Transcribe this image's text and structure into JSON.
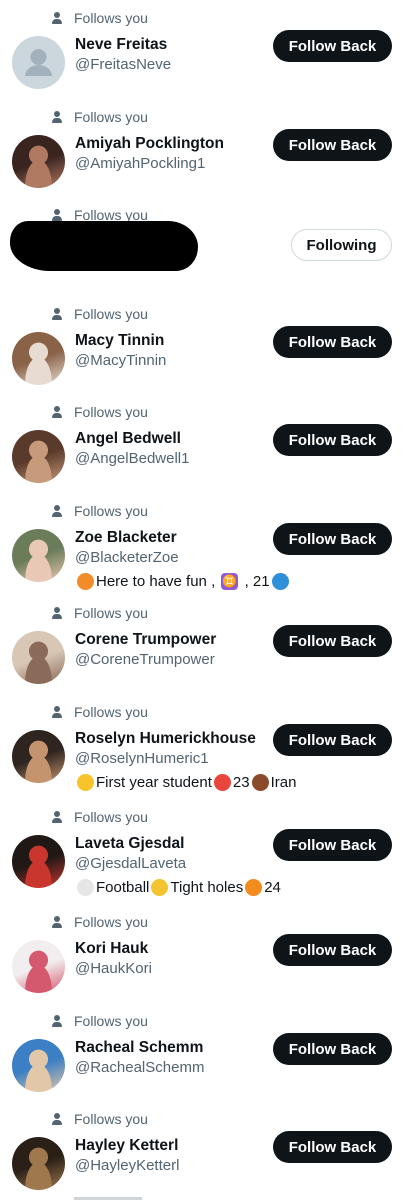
{
  "follows_label": "Follows you",
  "follow_back_label": "Follow Back",
  "following_label": "Following",
  "users": [
    {
      "name": "Neve Freitas",
      "handle": "@FreitasNeve",
      "button": "follow_back",
      "avatar": "default"
    },
    {
      "name": "Amiyah Pocklington",
      "handle": "@AmiyahPockling1",
      "button": "follow_back",
      "avatar": "photo",
      "colors": [
        "#3a2420",
        "#b07a62"
      ]
    },
    {
      "name": "",
      "handle": "",
      "button": "following",
      "avatar": "redacted"
    },
    {
      "name": "Macy Tinnin",
      "handle": "@MacyTinnin",
      "button": "follow_back",
      "avatar": "photo",
      "colors": [
        "#8a6248",
        "#e8dcd2"
      ]
    },
    {
      "name": "Angel Bedwell",
      "handle": "@AngelBedwell1",
      "button": "follow_back",
      "avatar": "photo",
      "colors": [
        "#5a3a2a",
        "#c79a7c"
      ]
    },
    {
      "name": "Zoe Blacketer",
      "handle": "@BlacketerZoe",
      "button": "follow_back",
      "avatar": "photo",
      "colors": [
        "#6b7c5a",
        "#e9c9b5"
      ],
      "bio": [
        {
          "t": "emoji",
          "name": "carrot-emoji",
          "color": "#f28c28"
        },
        {
          "t": "text",
          "v": "Here to have fun , "
        },
        {
          "t": "emoji",
          "name": "gemini-emoji",
          "color": "#8e5bd6",
          "glyph": "♊"
        },
        {
          "t": "text",
          "v": " , 21"
        },
        {
          "t": "emoji",
          "name": "globe-emoji",
          "color": "#2f8fd8"
        }
      ]
    },
    {
      "name": "Corene Trumpower",
      "handle": "@CoreneTrumpower",
      "button": "follow_back",
      "avatar": "photo",
      "colors": [
        "#d9c7b6",
        "#8a6a58"
      ]
    },
    {
      "name": "Roselyn Humerickhouse",
      "handle": "@RoselynHumeric1",
      "button": "follow_back",
      "avatar": "photo",
      "colors": [
        "#2e2420",
        "#c4946e"
      ],
      "bio": [
        {
          "t": "emoji",
          "name": "chick-emoji",
          "color": "#f7c52b"
        },
        {
          "t": "text",
          "v": "First year student"
        },
        {
          "t": "emoji",
          "name": "gift-emoji",
          "color": "#e8463c"
        },
        {
          "t": "text",
          "v": "23"
        },
        {
          "t": "emoji",
          "name": "brown-heart-emoji",
          "color": "#8b4a2a"
        },
        {
          "t": "text",
          "v": "Iran"
        }
      ]
    },
    {
      "name": "Laveta Gjesdal",
      "handle": "@GjesdalLaveta",
      "button": "follow_back",
      "avatar": "photo",
      "colors": [
        "#1f1815",
        "#c8362e"
      ],
      "bio": [
        {
          "t": "emoji",
          "name": "white-heart-emoji",
          "color": "#e6e6e6"
        },
        {
          "t": "text",
          "v": "Football"
        },
        {
          "t": "emoji",
          "name": "pointing-down-emoji",
          "color": "#f4c430"
        },
        {
          "t": "text",
          "v": "Tight holes"
        },
        {
          "t": "emoji",
          "name": "tangerine-emoji",
          "color": "#f28c1e"
        },
        {
          "t": "text",
          "v": "24"
        }
      ]
    },
    {
      "name": "Kori Hauk",
      "handle": "@HaukKori",
      "button": "follow_back",
      "avatar": "photo",
      "colors": [
        "#f2eef0",
        "#d4586e"
      ]
    },
    {
      "name": "Racheal Schemm",
      "handle": "@RachealSchemm",
      "button": "follow_back",
      "avatar": "photo",
      "colors": [
        "#3b7fc4",
        "#e2c7a8"
      ]
    },
    {
      "name": "Hayley Ketterl",
      "handle": "@HayleyKetterl",
      "button": "follow_back",
      "avatar": "photo",
      "colors": [
        "#2a2018",
        "#a0784e"
      ]
    }
  ]
}
